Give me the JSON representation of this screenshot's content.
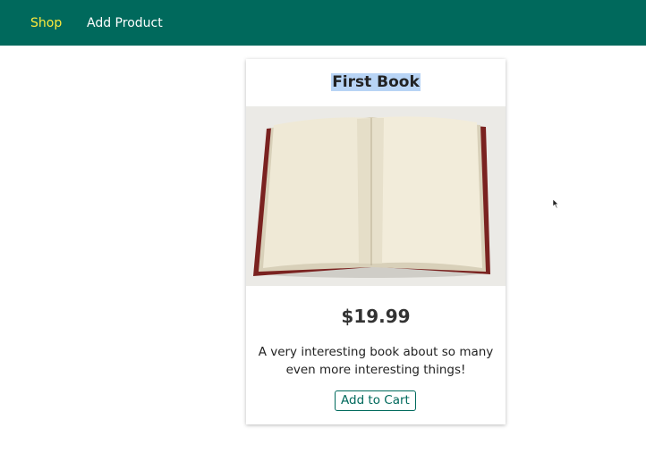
{
  "nav": {
    "items": [
      {
        "label": "Shop",
        "active": true
      },
      {
        "label": "Add Product",
        "active": false
      }
    ],
    "background_color": "#00695c",
    "active_color": "#ffeb3b"
  },
  "product": {
    "title": "First Book",
    "image": "open-book-image",
    "price": "$19.99",
    "description": "A very interesting book about so many even more interesting things!",
    "cart_button_label": "Add to Cart"
  }
}
